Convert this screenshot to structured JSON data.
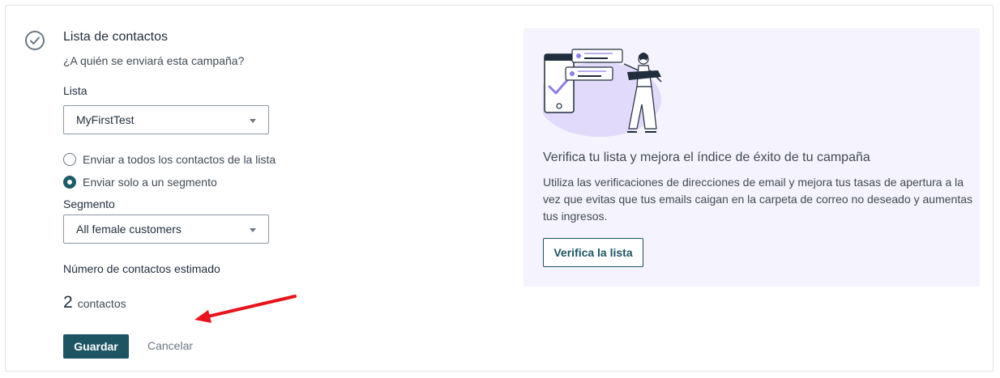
{
  "section": {
    "title": "Lista de contactos",
    "subtitle": "¿A quién se enviará esta campaña?"
  },
  "list": {
    "label": "Lista",
    "selected": "MyFirstTest"
  },
  "recipients": {
    "option_all": "Enviar a todos los contactos de la lista",
    "option_segment": "Enviar solo a un segmento",
    "selected_option": "segment"
  },
  "segment": {
    "label": "Segmento",
    "selected": "All female customers"
  },
  "estimate": {
    "label": "Número de contactos estimado",
    "count": "2",
    "unit": "contactos"
  },
  "actions": {
    "save": "Guardar",
    "cancel": "Cancelar"
  },
  "promo": {
    "title": "Verifica tu lista y mejora el índice de éxito de tu campaña",
    "description": "Utiliza las verificaciones de direcciones de email y mejora tus tasas de apertura a la vez que evitas que tus emails caigan en la carpeta de correo no deseado y aumentas tus ingresos.",
    "button": "Verifica la lista"
  },
  "icons": {
    "status": "check-circle-icon",
    "select_caret": "caret-down-icon",
    "annotation": "red-arrow-icon",
    "illustration": "list-verification-illustration"
  },
  "colors": {
    "primary": "#1e5563",
    "promo_background": "#f5f3fd",
    "arrow": "#e8141b"
  }
}
